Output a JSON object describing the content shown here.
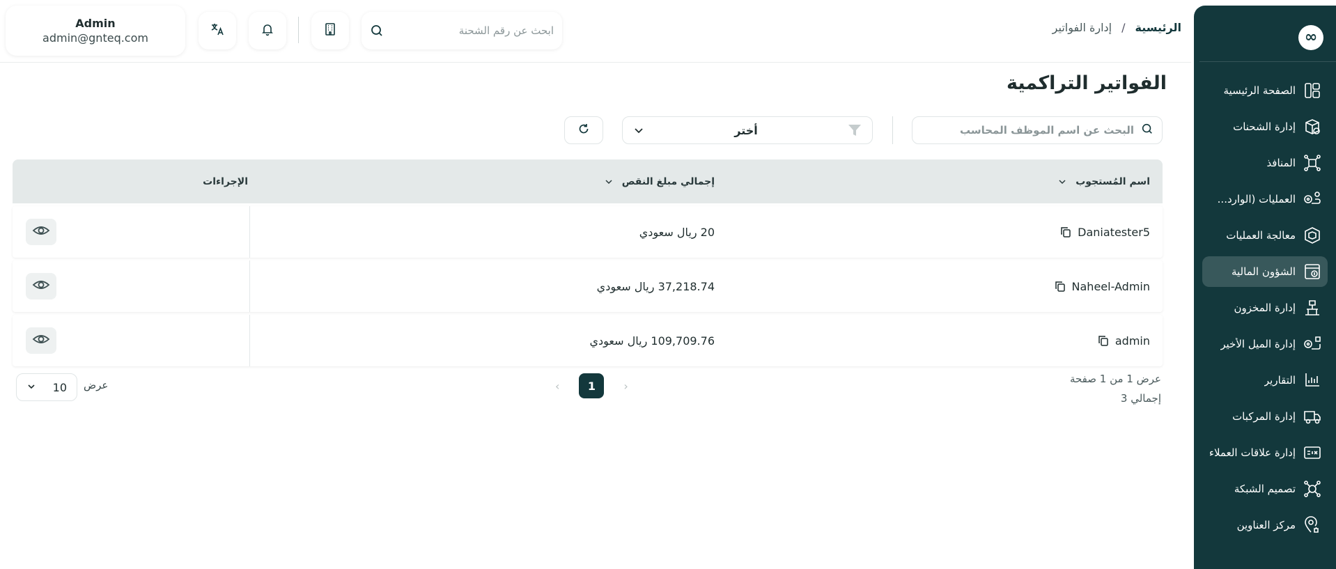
{
  "breadcrumb": {
    "home": "الرئيسية",
    "separator": "/",
    "current": "إدارة الفواتير"
  },
  "shipment_search": {
    "placeholder": "ابحث عن رقم الشحنة"
  },
  "user": {
    "name": "Admin",
    "email": "admin@gnteq.com"
  },
  "page_title": "الفواتير التراكمية",
  "filters": {
    "employee_search_placeholder": "البحث عن اسم الموظف المحاسب",
    "select_value": "أختر"
  },
  "table": {
    "headers": {
      "name": "اسم المُستجوب",
      "amount": "إجمالي مبلغ النقص",
      "actions": "الإجراءات"
    },
    "rows": [
      {
        "name": "Daniatester5",
        "amount": "20 ريال سعودي"
      },
      {
        "name": "Naheel-Admin",
        "amount": "37,218.74 ريال سعودي"
      },
      {
        "name": "admin",
        "amount": "109,709.76 ريال سعودي"
      }
    ]
  },
  "pagination": {
    "page_info": "عرض 1 من 1 صفحة",
    "total": "إجمالي 3",
    "current_page": "1",
    "page_size_label": "عرض",
    "page_size": "10"
  },
  "sidebar": {
    "logo": "∞",
    "items": [
      {
        "label": "الصفحة الرئيسية",
        "icon": "dashboard-icon",
        "active": false
      },
      {
        "label": "إدارة الشحنات",
        "icon": "package-icon",
        "active": false
      },
      {
        "label": "المنافذ",
        "icon": "network-icon",
        "active": false
      },
      {
        "label": "العمليات (الوارد...",
        "icon": "route-icon",
        "active": false
      },
      {
        "label": "معالجة العمليات",
        "icon": "box-icon",
        "active": false
      },
      {
        "label": "الشؤون المالية",
        "icon": "finance-icon",
        "active": true
      },
      {
        "label": "إدارة المخزون",
        "icon": "warehouse-icon",
        "active": false
      },
      {
        "label": "إدارة الميل الأخير",
        "icon": "last-mile-icon",
        "active": false
      },
      {
        "label": "التقارير",
        "icon": "reports-icon",
        "active": false
      },
      {
        "label": "إدارة المركبات",
        "icon": "truck-icon",
        "active": false
      },
      {
        "label": "إدارة علاقات العملاء",
        "icon": "crm-icon",
        "active": false
      },
      {
        "label": "تصميم الشبكة",
        "icon": "network-design-icon",
        "active": false
      },
      {
        "label": "مركز العناوين",
        "icon": "location-icon",
        "active": false
      }
    ]
  },
  "colors": {
    "primary": "#13383c",
    "header_bg": "#e4e9e9",
    "background": "#ffffff"
  }
}
